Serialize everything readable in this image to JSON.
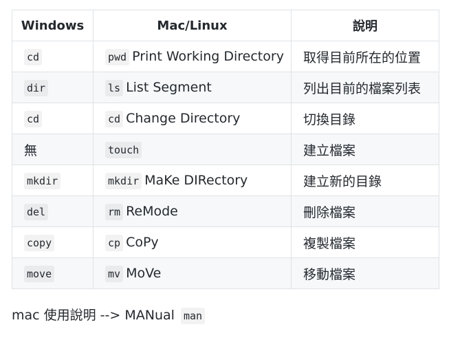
{
  "table": {
    "headers": [
      "Windows",
      "Mac/Linux",
      "說明"
    ],
    "rows": [
      {
        "windows": "cd",
        "win_code": true,
        "mac_code": "pwd",
        "mac_desc": "Print Working Directory",
        "note": "取得目前所在的位置"
      },
      {
        "windows": "dir",
        "win_code": true,
        "mac_code": "ls",
        "mac_desc": "List Segment",
        "note": "列出目前的檔案列表"
      },
      {
        "windows": "cd",
        "win_code": true,
        "mac_code": "cd",
        "mac_desc": "Change Directory",
        "note": "切換目錄"
      },
      {
        "windows": "無",
        "win_code": false,
        "mac_code": "touch",
        "mac_desc": "",
        "note": "建立檔案"
      },
      {
        "windows": "mkdir",
        "win_code": true,
        "mac_code": "mkdir",
        "mac_desc": "MaKe DIRectory",
        "note": "建立新的目錄"
      },
      {
        "windows": "del",
        "win_code": true,
        "mac_code": "rm",
        "mac_desc": "ReMode",
        "note": "刪除檔案"
      },
      {
        "windows": "copy",
        "win_code": true,
        "mac_code": "cp",
        "mac_desc": "CoPy",
        "note": "複製檔案"
      },
      {
        "windows": "move",
        "win_code": true,
        "mac_code": "mv",
        "mac_desc": "MoVe",
        "note": "移動檔案"
      }
    ]
  },
  "footer": {
    "text": "mac 使用說明 --> MANual",
    "code": "man"
  },
  "colors": {
    "text": "#24292e",
    "border": "#dfe2e5",
    "stripe": "#f6f8fa",
    "code_bg": "rgba(27,31,35,0.06)"
  }
}
